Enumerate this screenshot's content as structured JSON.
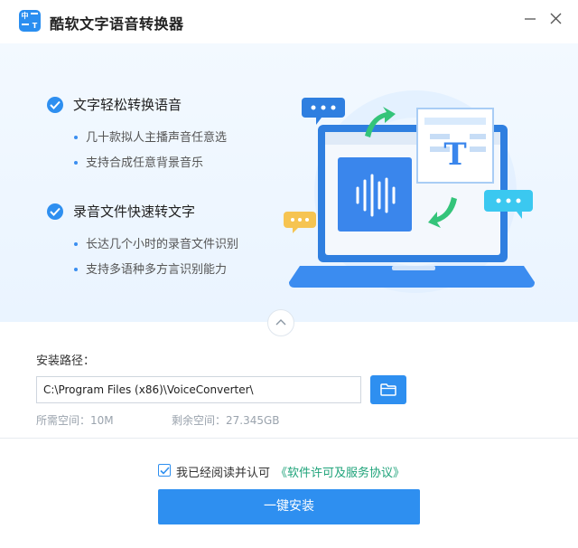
{
  "window": {
    "title": "酷软文字语音转换器",
    "logo_glyphs": [
      "中",
      "T"
    ]
  },
  "features": [
    {
      "title": "文字轻松转换语音",
      "bullets": [
        "几十款拟人主播声音任意选",
        "支持合成任意背景音乐"
      ]
    },
    {
      "title": "录音文件快速转文字",
      "bullets": [
        "长达几个小时的录音文件识别",
        "支持多语种多方言识别能力"
      ]
    }
  ],
  "illustration": {
    "document_glyph": "T"
  },
  "install": {
    "path_label": "安装路径：",
    "path_value": "C:\\Program Files (x86)\\VoiceConverter\\",
    "space_required": "所需空间：10M",
    "space_free": "剩余空间：27.345GB"
  },
  "agreement": {
    "checked": true,
    "text": "我已经阅读并认可",
    "link": "《软件许可及服务协议》"
  },
  "install_button": "一键安装",
  "colors": {
    "accent": "#2e8ff0",
    "link": "#1fa37a",
    "banner_bg": "#eef6ff"
  }
}
